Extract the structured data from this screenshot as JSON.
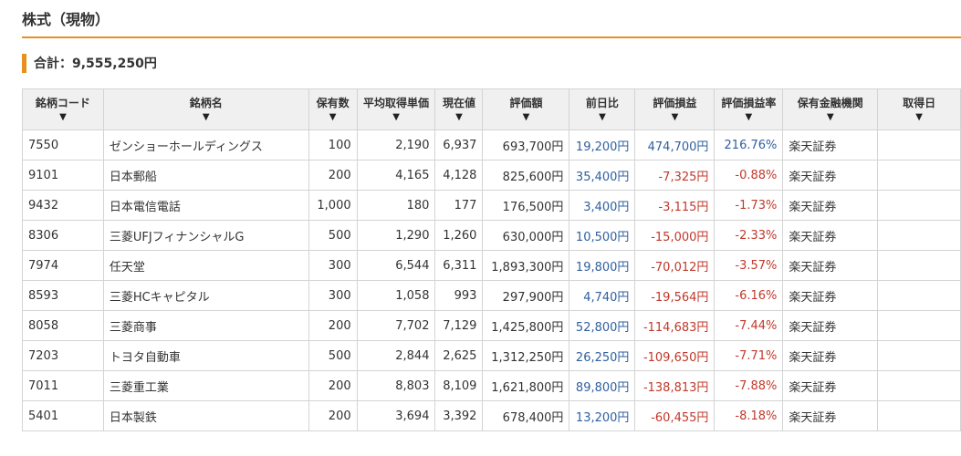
{
  "section": {
    "title": "株式（現物）"
  },
  "summary": {
    "total": "合計：9,555,250円"
  },
  "table": {
    "sort_arrow": "▼",
    "headers": [
      "銘柄コード",
      "銘柄名",
      "保有数",
      "平均取得単価",
      "現在値",
      "評価額",
      "前日比",
      "評価損益",
      "評価損益率",
      "保有金融機関",
      "取得日"
    ],
    "rows": [
      [
        "7550",
        "ゼンショーホールディングス",
        "100",
        "2,190",
        "6,937",
        "693,700円",
        "19,200円",
        "474,700円",
        "216.76%",
        "楽天証券",
        ""
      ],
      [
        "9101",
        "日本郵船",
        "200",
        "4,165",
        "4,128",
        "825,600円",
        "35,400円",
        "-7,325円",
        "-0.88%",
        "楽天証券",
        ""
      ],
      [
        "9432",
        "日本電信電話",
        "1,000",
        "180",
        "177",
        "176,500円",
        "3,400円",
        "-3,115円",
        "-1.73%",
        "楽天証券",
        ""
      ],
      [
        "8306",
        "三菱UFJフィナンシャルG",
        "500",
        "1,290",
        "1,260",
        "630,000円",
        "10,500円",
        "-15,000円",
        "-2.33%",
        "楽天証券",
        ""
      ],
      [
        "7974",
        "任天堂",
        "300",
        "6,544",
        "6,311",
        "1,893,300円",
        "19,800円",
        "-70,012円",
        "-3.57%",
        "楽天証券",
        ""
      ],
      [
        "8593",
        "三菱HCキャピタル",
        "300",
        "1,058",
        "993",
        "297,900円",
        "4,740円",
        "-19,564円",
        "-6.16%",
        "楽天証券",
        ""
      ],
      [
        "8058",
        "三菱商事",
        "200",
        "7,702",
        "7,129",
        "1,425,800円",
        "52,800円",
        "-114,683円",
        "-7.44%",
        "楽天証券",
        ""
      ],
      [
        "7203",
        "トヨタ自動車",
        "500",
        "2,844",
        "2,625",
        "1,312,250円",
        "26,250円",
        "-109,650円",
        "-7.71%",
        "楽天証券",
        ""
      ],
      [
        "7011",
        "三菱重工業",
        "200",
        "8,803",
        "8,109",
        "1,621,800円",
        "89,800円",
        "-138,813円",
        "-7.88%",
        "楽天証券",
        ""
      ],
      [
        "5401",
        "日本製鉄",
        "200",
        "3,694",
        "3,392",
        "678,400円",
        "13,200円",
        "-60,455円",
        "-8.18%",
        "楽天証券",
        ""
      ]
    ]
  },
  "colors": {
    "accent": "#e8901e",
    "positive": "#3060a0",
    "negative": "#c0392b",
    "header_bg": "#f0f0f0",
    "border": "#d4d4d4"
  },
  "icons": {
    "sort": "sort-down-arrow-icon"
  }
}
